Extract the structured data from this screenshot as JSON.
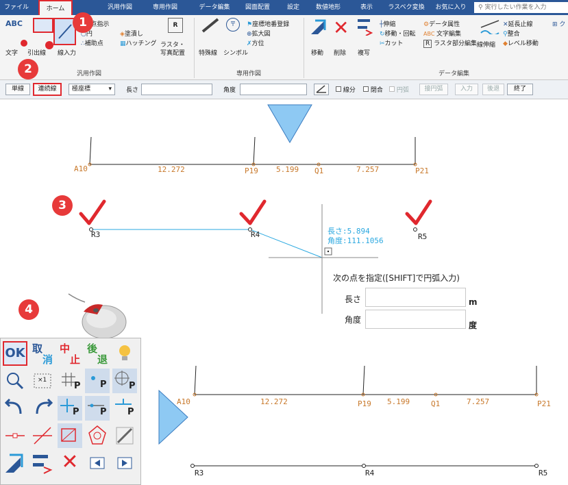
{
  "ribbon": {
    "tabs": [
      "ファイル",
      "ホーム",
      "汎用作図",
      "専用作図",
      "データ編集",
      "図面配置",
      "設定",
      "数値地形",
      "表示",
      "ラスベク変換",
      "お気に入り"
    ],
    "search_placeholder": "実行したい作業を入力",
    "group_general": "汎用作図",
    "group_special": "専用作図",
    "group_edit": "データ編集",
    "items": {
      "text": "文字",
      "abc": "ABC",
      "leader": "引出線",
      "line_input": "線入力",
      "two_point": "2点指示",
      "circle": "円",
      "fill": "塗潰し",
      "aux_point": "補助点",
      "hatching": "ハッチング",
      "raster": "ラスタ・",
      "photo": "写真配置",
      "special_line": "特殊線",
      "symbol": "シンボル",
      "coord_register": "座標地番登録",
      "enlarge": "拡大図",
      "direction": "方位",
      "move": "移動",
      "delete": "削除",
      "copy": "複写",
      "extend": "伸縮",
      "move_rotate": "移動・回転",
      "cut": "カット",
      "data_attr": "データ属性",
      "text_edit": "文字編集",
      "raster_edit": "ラスタ部分編集",
      "line_extend": "線伸縮",
      "extend_stop": "延長止線",
      "align": "整合",
      "level_move": "レベル移動"
    }
  },
  "cmdbar": {
    "single": "単線",
    "continuous": "連続線",
    "polar": "極座標",
    "length_label": "長さ",
    "angle_label": "角度",
    "segment": "線分",
    "closed": "閉合",
    "arc": "円弧",
    "tangent_arc": "接円弧",
    "input": "入力",
    "back": "後退",
    "end": "終了"
  },
  "badges": [
    "1",
    "2",
    "3",
    "4"
  ],
  "drawing_top": {
    "points": [
      "A10",
      "P19",
      "Q1",
      "P21"
    ],
    "distances": [
      "12.272",
      "5.199",
      "7.257"
    ]
  },
  "drawing_step3": {
    "points": [
      "R3",
      "R4",
      "R5"
    ],
    "length_readout": "長さ:5.894",
    "angle_readout": "角度:111.1056",
    "prompt": "次の点を指定([SHIFT]で円弧入力)",
    "length_field_label": "長さ",
    "angle_field_label": "角度",
    "length_unit": "m",
    "angle_unit": "度"
  },
  "drawing_bottom": {
    "points": [
      "A10",
      "P19",
      "Q1",
      "P21"
    ],
    "distances": [
      "12.272",
      "5.199",
      "7.257"
    ],
    "result_points": [
      "R3",
      "R4",
      "R5"
    ]
  },
  "palette": {
    "ok": "OK",
    "cancel_char1": "取",
    "cancel_char2": "消",
    "abort_char1": "中",
    "abort_char2": "止",
    "back_char1": "後",
    "back_char2": "退",
    "scale": "×1",
    "p": "P"
  },
  "colors": {
    "ribbon_blue": "#2b5797",
    "highlight_red": "#e0282e",
    "badge_red": "#e73a3a",
    "cad_orange": "#c8782a",
    "cad_cyan": "#2aa8e0",
    "triangle_blue": "#8ec9f3"
  }
}
